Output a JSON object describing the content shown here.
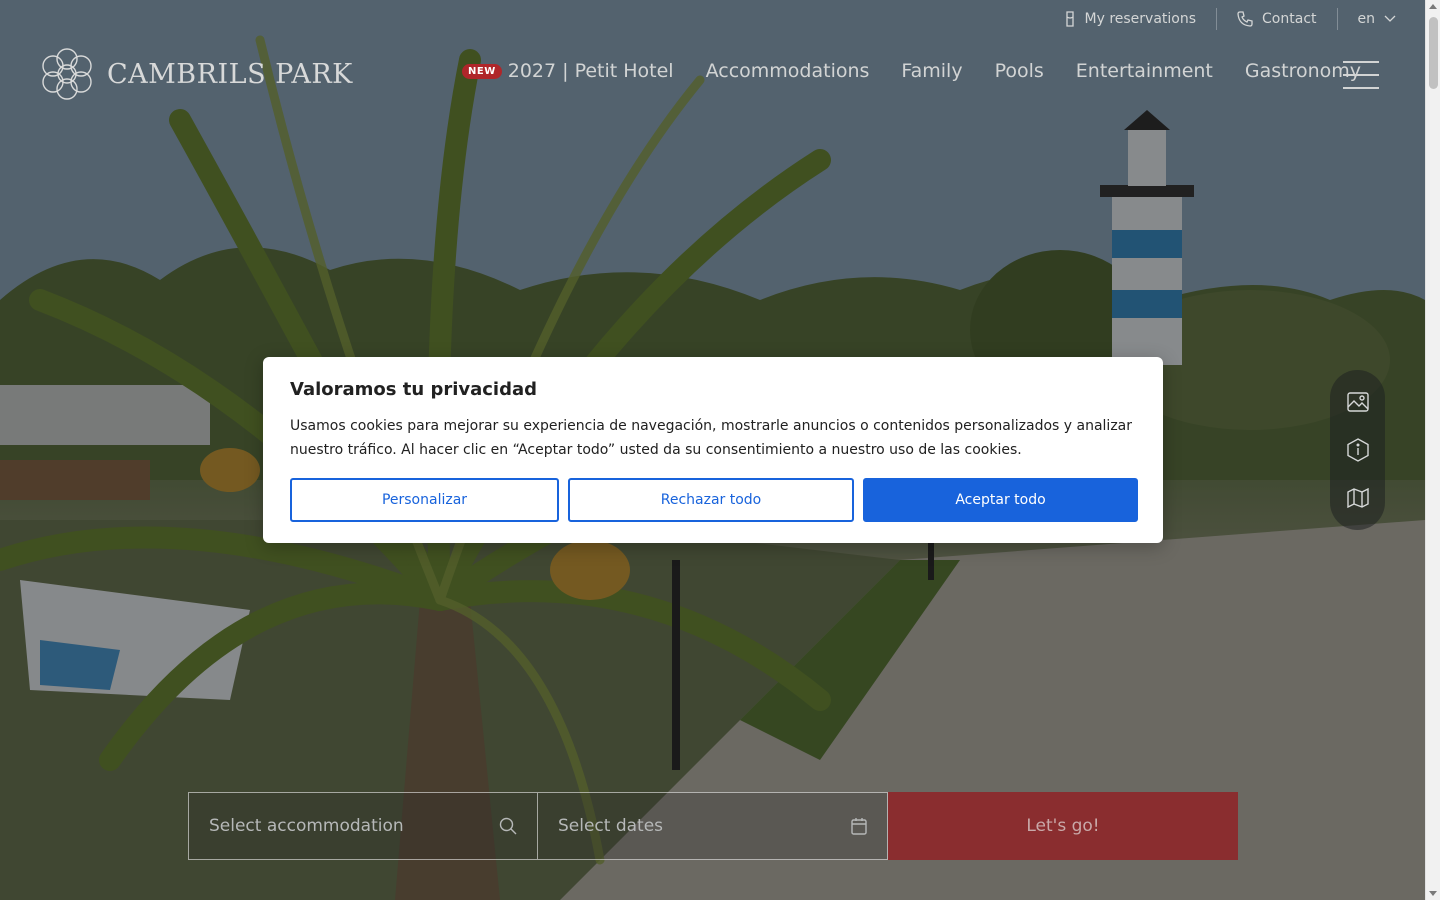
{
  "utility_bar": {
    "reservations_label": "My reservations",
    "contact_label": "Contact",
    "language": "en"
  },
  "brand": {
    "name": "CAMBRILS PARK"
  },
  "nav": {
    "badge": "NEW",
    "items": [
      "2027 | Petit Hotel",
      "Accommodations",
      "Family",
      "Pools",
      "Entertainment",
      "Gastronomy"
    ]
  },
  "side_tools": [
    "image-icon",
    "info-icon",
    "map-icon"
  ],
  "booking": {
    "accommodation_placeholder": "Select accommodation",
    "dates_placeholder": "Select dates",
    "submit_label": "Let's go!"
  },
  "cookie_banner": {
    "title": "Valoramos tu privacidad",
    "text": "Usamos cookies para mejorar su experiencia de navegación, mostrarle anuncios o contenidos personalizados y analizar nuestro tráfico. Al hacer clic en “Aceptar todo” usted da su consentimiento a nuestro uso de las cookies.",
    "customize_label": "Personalizar",
    "reject_label": "Rechazar todo",
    "accept_label": "Aceptar todo"
  },
  "colors": {
    "primary_blue": "#1863dc",
    "booking_red": "#8a2d2f",
    "badge_red": "#b0262a"
  }
}
